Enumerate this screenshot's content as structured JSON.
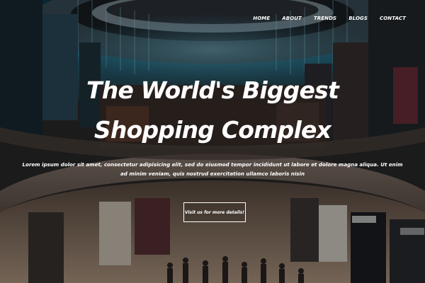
{
  "nav": {
    "items": [
      "HOME",
      "ABOUT",
      "TRENDS",
      "BLOGS",
      "CONTACT"
    ]
  },
  "hero": {
    "title": "The World's Biggest Shopping Complex",
    "lead": "Lorem ipsum dolor sit amet, consectetur adipisicing elit, sed do eiusmod tempor incididunt ut labore et dolore magna aliqua. Ut enim ad minim veniam, quis nostrud exercitation ullamco laboris nisin",
    "cta_label": "Visit us for more details!"
  },
  "theme": {
    "text_color": "#ffffff",
    "ceiling_accent": "#3fa6c8",
    "floor_tone": "#a8907a"
  }
}
